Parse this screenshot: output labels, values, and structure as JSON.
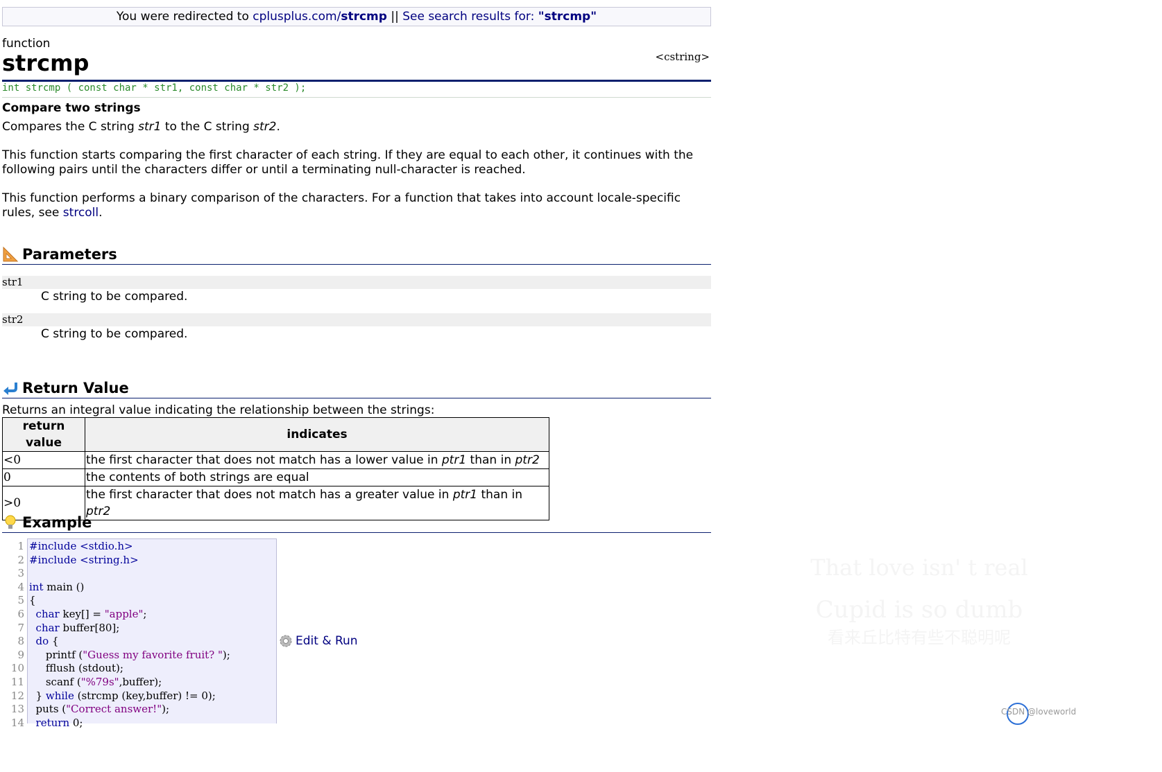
{
  "redirect": {
    "prefix": "You were redirected to ",
    "link_plain": "cplusplus.com/",
    "link_bold": "strcmp",
    "sep": " || ",
    "search_label": "See search results for: ",
    "search_term": "\"strcmp\""
  },
  "page": {
    "kind": "function",
    "title": "strcmp",
    "header": "<cstring>",
    "prototype": "int strcmp ( const char * str1, const char * str2 );",
    "short_desc": "Compare two strings",
    "p1_pre": "Compares the C string ",
    "p1_a": "str1",
    "p1_mid": " to the C string ",
    "p1_b": "str2",
    "p1_end": ".",
    "p2": "This function starts comparing the first character of each string. If they are equal to each other, it continues with the following pairs until the characters differ or until a terminating null-character is reached.",
    "p3_pre": "This function performs a binary comparison of the characters. For a function that takes into account locale-specific rules, see ",
    "p3_link": "strcoll",
    "p3_end": "."
  },
  "parameters": {
    "title": "Parameters",
    "items": [
      {
        "name": "str1",
        "desc": "C string to be compared."
      },
      {
        "name": "str2",
        "desc": "C string to be compared."
      }
    ]
  },
  "return_value": {
    "title": "Return Value",
    "desc": "Returns an integral value indicating the relationship between the strings:",
    "headers": [
      "return value",
      "indicates"
    ],
    "rows": [
      {
        "value": "<0",
        "pre": "the first character that does not match has a lower value in ",
        "a": "ptr1",
        "mid": " than in ",
        "b": "ptr2"
      },
      {
        "value": "0",
        "pre": "the contents of both strings are equal",
        "a": "",
        "mid": "",
        "b": ""
      },
      {
        "value": ">0",
        "pre": "the first character that does not match has a greater value in ",
        "a": "ptr1",
        "mid": " than in ",
        "b": "ptr2"
      }
    ]
  },
  "example": {
    "title": "Example",
    "edit_run": "Edit & Run",
    "line_numbers": [
      "1",
      "2",
      "3",
      "4",
      "5",
      "6",
      "7",
      "8",
      "9",
      "10",
      "11",
      "12",
      "13",
      "14"
    ]
  },
  "watermark": {
    "line1": "That love isn' t real",
    "line2": "Cupid is so dumb",
    "line3": "看来丘比特有些不聪明呢",
    "csdn": "CSDN @loveworld"
  },
  "colors": {
    "link": "#000080",
    "rule": "#0a1f6e",
    "prototype": "#2a8a2a",
    "code_bg": "#eeeefc"
  }
}
